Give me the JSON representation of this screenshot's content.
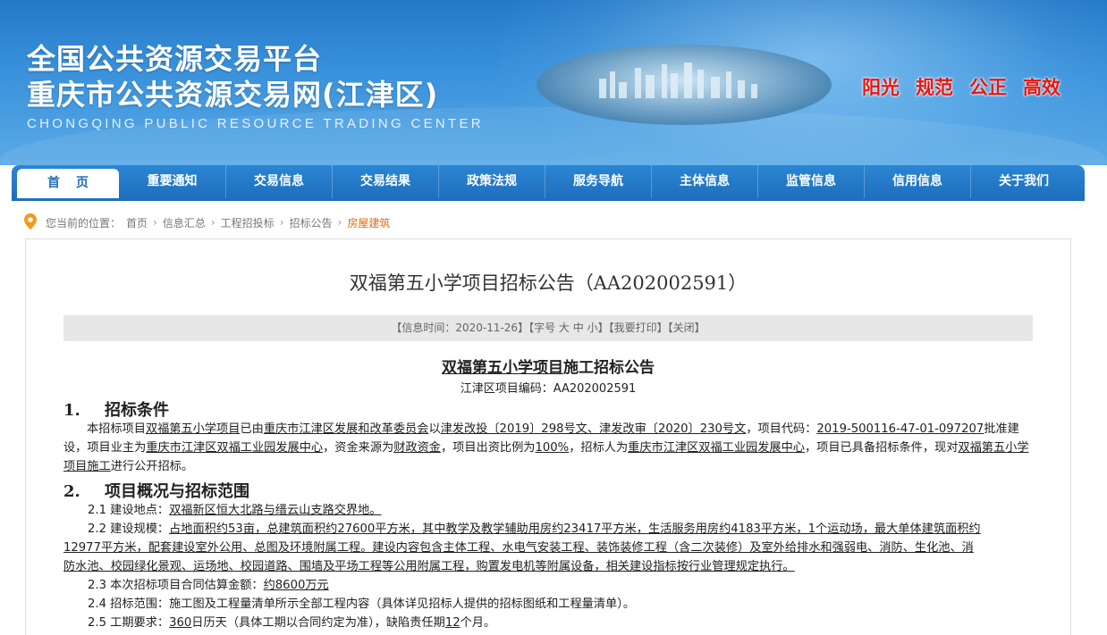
{
  "header": {
    "title_line1": "全国公共资源交易平台",
    "title_line2": "重庆市公共资源交易网(江津区)",
    "subtitle_en": "CHONGQING PUBLIC RESOURCE TRADING CENTER",
    "slogans": [
      "阳光",
      "规范",
      "公正",
      "高效"
    ]
  },
  "nav": {
    "items": [
      "首页",
      "重要通知",
      "交易信息",
      "交易结果",
      "政策法规",
      "服务导航",
      "主体信息",
      "监管信息",
      "信用信息",
      "关于我们"
    ]
  },
  "breadcrumb": {
    "prefix": "您当前的位置：",
    "items": [
      "首页",
      "信息汇总",
      "工程招投标",
      "招标公告",
      "房屋建筑"
    ],
    "separator": "›"
  },
  "article": {
    "title": "双福第五小学项目招标公告（AA202002591）",
    "info": {
      "time_label": "【信息时间：2020-11-26】",
      "font_label": "【字号",
      "font_large": "大",
      "font_medium": "中",
      "font_small": "小",
      "font_close": "】",
      "print": "【我要打印】",
      "close": "【关闭】"
    },
    "subtitle_underlined": "双福第五小学项目",
    "subtitle_rest": "施工招标公告",
    "code_line": "江津区项目编码：AA202002591",
    "section1": {
      "num": "1.",
      "title": "招标条件",
      "p1": "本招标项目",
      "p2": "双福第五小学项目",
      "p3": "已由",
      "p4": "重庆市江津区发展和改革委员会",
      "p5": "以",
      "p6": "津发改投〔2019〕298号文、津发改审〔2020〕230号文",
      "p7": "，项目代码：",
      "p8": "2019-500116-47-01-097207",
      "p9": "批准建设，项目业主为",
      "p10": "重庆市江津区双福工业园发展中心",
      "p11": "，资金来源为",
      "p12": "财政资金",
      "p13": "，项目出资比例为",
      "p14": "100%",
      "p15": "，招标人为",
      "p16": "重庆市江津区双福工业园发展中心",
      "p17": "，项目已具备招标条件，现对",
      "p18": "双福第五小学项目施工",
      "p19": "进行公开招标。"
    },
    "section2": {
      "num": "2.",
      "title": "项目概况与招标范围",
      "l1_label": "2.1 建设地点：",
      "l1_val": "双福新区恒大北路与缙云山支路交界地。",
      "l2_label": "2.2 建设规模：",
      "l2_val_a": "占地面积约53亩，总建筑面积约27600平方米，其中教学及教学辅助用房约23417平方米，生活服务用房约4183平方米，1个运动场，最大单体建筑面积约",
      "l2_val_b": "12977平方米，配套建设室外公用、总图及环境附属工程。建设内容包含主体工程、水电气安装工程、装饰装修工程（含二次装修）及室外给排水和强弱电、消防、生化池、消",
      "l2_val_c": "防水池、校园绿化景观、运场地、校园道路、围墙及平场工程等公用附属工程，购置发电机等附属设备，相关建设指标按行业管理规定执行。",
      "l3_label": "2.3 本次招标项目合同估算金额：",
      "l3_val": "约8600万元",
      "l4_label": "2.4 招标范围：",
      "l4_val": "施工图及工程量清单所示全部工程内容（具体详见招标人提供的招标图纸和工程量清单）。",
      "l5_label": "2.5 工期要求：",
      "l5_val_a": "360",
      "l5_val_b": "日历天（具体工期以合同约定为准），缺陷责任期",
      "l5_val_c": "12",
      "l5_val_d": "个月。"
    }
  },
  "colors": {
    "nav_bg": "#1f6fbd",
    "slogan": "#e8160f",
    "crumb_current": "#e36a0c",
    "info_bg": "#e7e7e7"
  }
}
